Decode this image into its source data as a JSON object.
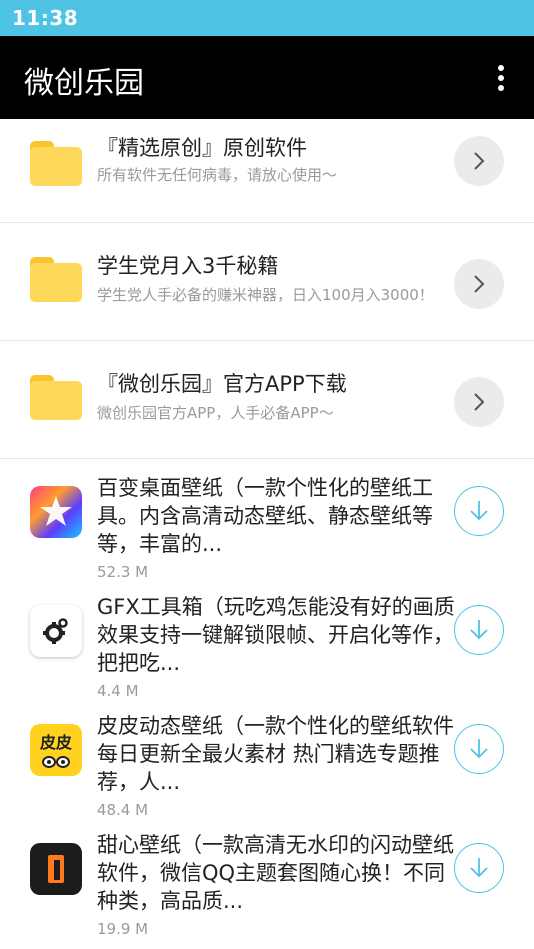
{
  "status_bar": {
    "time": "11:38"
  },
  "app_bar": {
    "title": "微创乐园"
  },
  "folders": [
    {
      "title": "『精选原创』原创软件",
      "subtitle": "所有软件无任何病毒，请放心使用～"
    },
    {
      "title": "学生党月入3千秘籍",
      "subtitle": "学生党人手必备的赚米神器，日入100月入3000！"
    },
    {
      "title": "『微创乐园』官方APP下载",
      "subtitle": "微创乐园官方APP，人手必备APP～"
    }
  ],
  "apps": [
    {
      "name": "百变桌面壁纸（一款个性化的壁纸工具。内含高清动态壁纸、静态壁纸等等，丰富的...",
      "size": "52.3 M",
      "icon": "bianbian-wallpaper-icon"
    },
    {
      "name": "GFX工具箱（玩吃鸡怎能没有好的画质效果支持一键解锁限帧、开启化等作，把把吃...",
      "size": "4.4 M",
      "icon": "gear-icon"
    },
    {
      "name": "皮皮动态壁纸（一款个性化的壁纸软件每日更新全最火素材 热门精选专题推荐，人...",
      "size": "48.4 M",
      "icon": "pipi-wallpaper-icon"
    },
    {
      "name": "甜心壁纸（一款高清无水印的闪动壁纸软件，微信QQ主题套图随心换！不同种类，高品质...",
      "size": "19.9 M",
      "icon": "tianxin-wallpaper-icon"
    }
  ],
  "icon_text": {
    "pipi": "皮皮"
  },
  "colors": {
    "status_bar": "#4ec3e4",
    "app_bar": "#000000",
    "folder": "#fdd85b",
    "accent": "#4ec3e4"
  }
}
